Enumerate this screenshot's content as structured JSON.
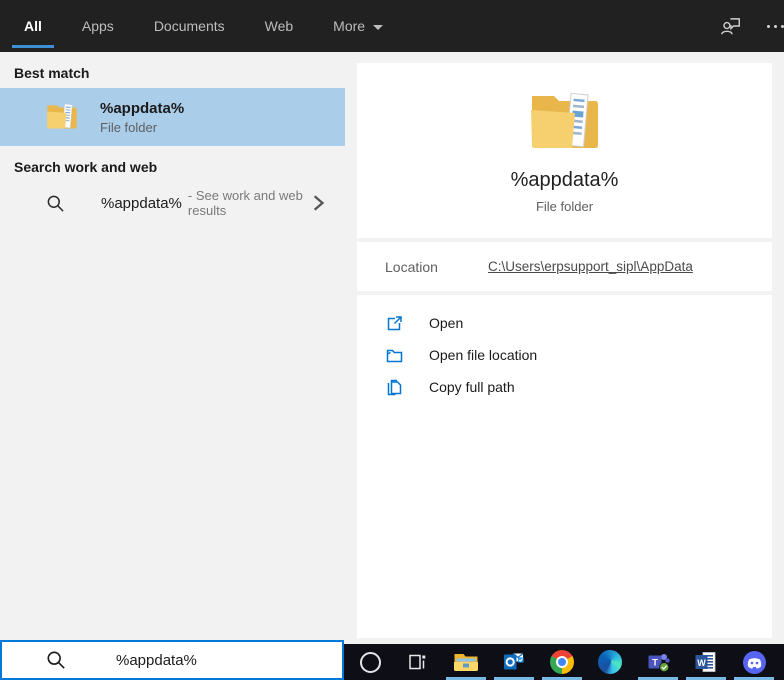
{
  "topbar": {
    "tabs": [
      {
        "label": "All",
        "active": true
      },
      {
        "label": "Apps",
        "active": false
      },
      {
        "label": "Documents",
        "active": false
      },
      {
        "label": "Web",
        "active": false
      },
      {
        "label": "More",
        "active": false,
        "has_dropdown": true
      }
    ],
    "icons": [
      "feedback-icon",
      "more-options-icon"
    ]
  },
  "left_panel": {
    "best_match_header": "Best match",
    "best_match": {
      "title": "%appdata%",
      "subtitle": "File folder"
    },
    "web_header": "Search work and web",
    "web_row": {
      "query": "%appdata%",
      "suffix": "- See work and web results"
    }
  },
  "right_panel": {
    "title": "%appdata%",
    "subtitle": "File folder",
    "location_label": "Location",
    "location_value": "C:\\Users\\erpsupport_sipl\\AppData",
    "actions": [
      {
        "icon": "open-icon",
        "label": "Open"
      },
      {
        "icon": "open-file-location-icon",
        "label": "Open file location"
      },
      {
        "icon": "copy-icon",
        "label": "Copy full path"
      }
    ]
  },
  "search_box": {
    "value": "%appdata%"
  },
  "taskbar": {
    "items": [
      {
        "name": "cortana",
        "running": false
      },
      {
        "name": "task-view",
        "running": false
      },
      {
        "name": "file-explorer",
        "running": true
      },
      {
        "name": "outlook",
        "running": true
      },
      {
        "name": "chrome",
        "running": true
      },
      {
        "name": "edge",
        "running": false
      },
      {
        "name": "teams",
        "running": true
      },
      {
        "name": "word",
        "running": true
      },
      {
        "name": "discord",
        "running": true
      }
    ]
  },
  "colors": {
    "accent": "#0078d7",
    "tab_underline": "#3d8fd6",
    "best_match_highlight": "#aacdea",
    "topbar_bg": "#212121",
    "taskbar_bg": "#0e0e16",
    "running_indicator": "#7ab8e8",
    "panel_bg": "#f2f2f2",
    "action_icon_blue": "#0077d4"
  }
}
